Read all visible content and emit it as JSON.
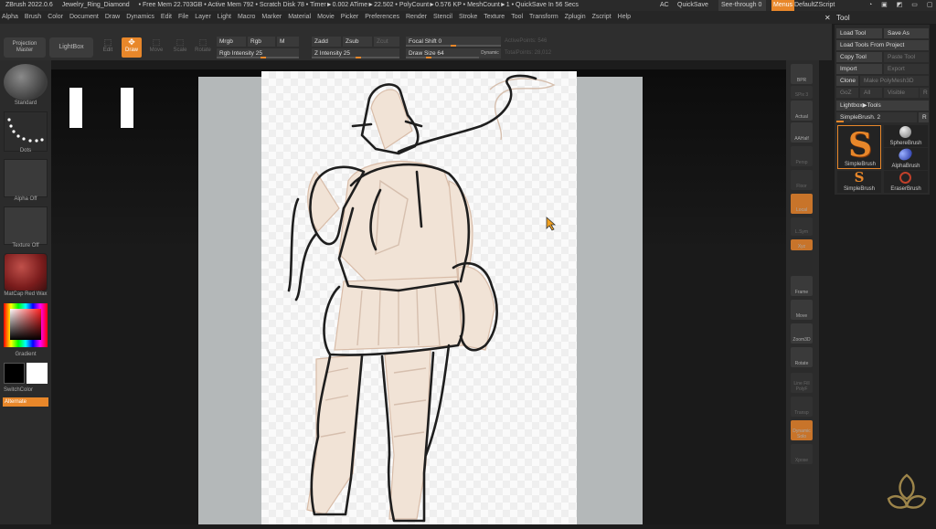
{
  "titlebar": {
    "app": "ZBrush 2022.0.6",
    "doc": "Jewelry_Ring_Diamond",
    "stats": "• Free Mem 22.703GB • Active Mem 792 • Scratch Disk 78 • Timer►0.002 ATime►22.502 • PolyCount►0.576 KP • MeshCount►1 • QuickSave In 56 Secs",
    "ac": "AC",
    "quicksave": "QuickSave",
    "see_through": "See-through 0",
    "menus": "Menus",
    "script": "DefaultZScript"
  },
  "menu": [
    "Alpha",
    "Brush",
    "Color",
    "Document",
    "Draw",
    "Dynamics",
    "Edit",
    "File",
    "Layer",
    "Light",
    "Macro",
    "Marker",
    "Material",
    "Movie",
    "Picker",
    "Preferences",
    "Render",
    "Stencil",
    "Stroke",
    "Texture",
    "Tool",
    "Transform",
    "Zplugin",
    "Zscript",
    "Help"
  ],
  "toolbar": {
    "projection_master": "Projection Master",
    "lightbox": "LightBox",
    "edit": "Edit",
    "draw": "Draw",
    "move": "Move",
    "scale": "Scale",
    "rotate": "Rotate",
    "mrgb": "Mrgb",
    "rgb": "Rgb",
    "m": "M",
    "rgb_intensity": "Rgb Intensity 25",
    "zadd": "Zadd",
    "zsub": "Zsub",
    "zcut": "Zcut",
    "z_intensity": "Z Intensity 25",
    "focal_shift": "Focal Shift 0",
    "draw_size": "Draw Size 64",
    "dynamic": "Dynamic",
    "active_points": "ActivePoints: 546",
    "total_points": "TotalPoints: 28,012"
  },
  "left": {
    "standard": "Standard",
    "dots": "Dots",
    "alpha_off": "Alpha Off",
    "texture_off": "Texture Off",
    "matcap": "MatCap Red Wax",
    "gradient": "Gradient",
    "switchcolor": "SwitchColor",
    "alternate": "Alternate"
  },
  "right_shelf": [
    "BPR",
    "SPix 3",
    "Actual",
    "AAHalf",
    "Persp",
    "Floor",
    "Local",
    "L.Sym",
    "Xyz",
    "Frame",
    "Move",
    "Zoom3D",
    "Rotate",
    "Line Fill PolyF",
    "Transp",
    "Dynamic Solo",
    "Xpose"
  ],
  "tool_panel": {
    "header": "Tool",
    "load_tool": "Load Tool",
    "save_as": "Save As",
    "load_from_project": "Load Tools From Project",
    "copy_tool": "Copy Tool",
    "paste_tool": "Paste Tool",
    "import": "Import",
    "export": "Export",
    "clone": "Clone",
    "make_polymesh": "Make PolyMesh3D",
    "goz": "GoZ",
    "all": "All",
    "visible": "Visible",
    "r": "R",
    "lightbox_tools": "Lightbox▶Tools",
    "current": "SimpleBrush. 2",
    "r2": "R",
    "brushes": [
      "SimpleBrush",
      "SphereBrush",
      "AlphaBrush",
      "SimpleBrush",
      "EraserBrush"
    ]
  },
  "colors": {
    "accent": "#e8872a",
    "bg": "#1c1c1c"
  }
}
